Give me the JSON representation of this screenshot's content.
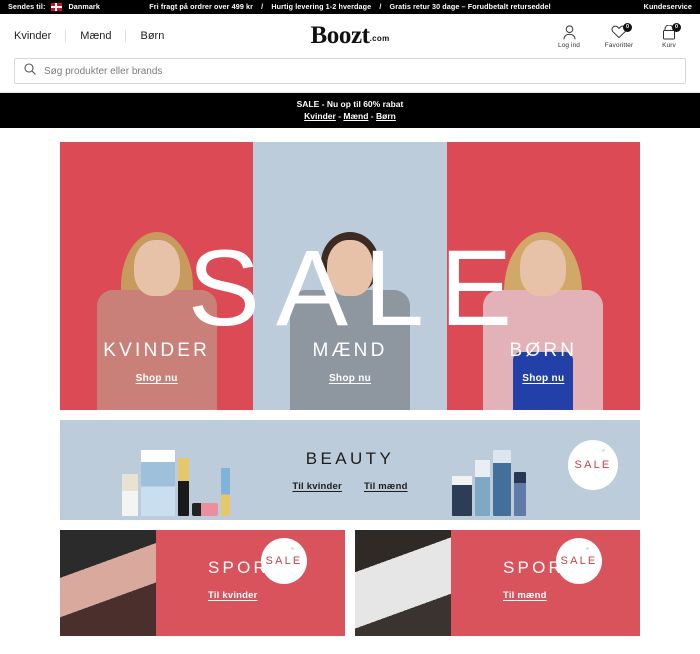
{
  "topbar": {
    "ship_label": "Sendes til:",
    "country": "Danmark",
    "flag_icon": "danish-flag-icon",
    "promo1": "Fri fragt på ordrer over 499 kr",
    "promo2": "Hurtig levering 1-2 hverdage",
    "promo3": "Gratis retur 30 dage – Forudbetalt returseddel",
    "sep": "/",
    "customer_service": "Kundeservice"
  },
  "header": {
    "nav": [
      {
        "label": "Kvinder"
      },
      {
        "label": "Mænd"
      },
      {
        "label": "Børn"
      }
    ],
    "logo": "Boozt",
    "logo_suffix": ".com",
    "tools": [
      {
        "label": "Log ind",
        "icon": "user-icon",
        "badge": null
      },
      {
        "label": "Favoritter",
        "icon": "heart-icon",
        "badge": "0"
      },
      {
        "label": "Kurv",
        "icon": "bag-icon",
        "badge": "0"
      }
    ]
  },
  "search": {
    "icon": "search-icon",
    "placeholder": "Søg produkter eller brands",
    "value": ""
  },
  "sale_strip": {
    "line1": "SALE - Nu op til 60% rabat",
    "links": [
      {
        "label": "Kvinder"
      },
      {
        "label": "Mænd"
      },
      {
        "label": "Børn"
      }
    ],
    "link_sep": " - "
  },
  "hero": {
    "big_word": "SALE",
    "panels": [
      {
        "title": "KVINDER",
        "cta": "Shop nu",
        "bg": "#DC4A55"
      },
      {
        "title": "MÆND",
        "cta": "Shop nu",
        "bg": "#BCCCDA"
      },
      {
        "title": "BØRN",
        "cta": "Shop nu",
        "bg": "#DC4A55"
      }
    ]
  },
  "beauty": {
    "title": "BEAUTY",
    "links": [
      {
        "label": "Til kvinder"
      },
      {
        "label": "Til mænd"
      }
    ],
    "sale_tag": "SALE",
    "bg": "#BCCCDA"
  },
  "sport": [
    {
      "title": "SPORT",
      "cta": "Til kvinder",
      "sale_tag": "SALE",
      "bg": "#D9535C"
    },
    {
      "title": "SPORT",
      "cta": "Til mænd",
      "sale_tag": "SALE",
      "bg": "#D9535C"
    }
  ],
  "colors": {
    "accent_red": "#DC4A55",
    "sale_red": "#C8404A",
    "panel_blue": "#BCCCDA",
    "black": "#000000"
  }
}
